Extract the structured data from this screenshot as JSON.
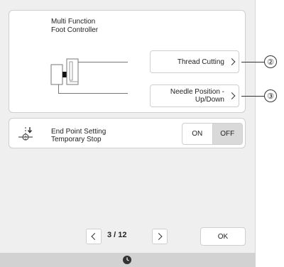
{
  "main_panel": {
    "title_line1": "Multi Function",
    "title_line2": "Foot Controller",
    "buttons": [
      {
        "label_line1": "Thread Cutting",
        "label_line2": ""
      },
      {
        "label_line1": "Needle Position -",
        "label_line2": "Up/Down"
      }
    ]
  },
  "callouts": [
    "②",
    "③"
  ],
  "end_point": {
    "label_line1": "End Point Setting",
    "label_line2": "Temporary Stop",
    "on_label": "ON",
    "off_label": "OFF",
    "selected": "OFF"
  },
  "pager": {
    "text": "3 / 12"
  },
  "ok_label": "OK",
  "colors": {
    "background": "#efefef",
    "panel": "#ffffff",
    "selected_toggle": "#d9d9d9",
    "footer": "#d2d2d2"
  },
  "icons": {
    "foot_controller": "foot-controller-icon",
    "end_point": "end-point-icon",
    "clock": "clock-icon"
  }
}
